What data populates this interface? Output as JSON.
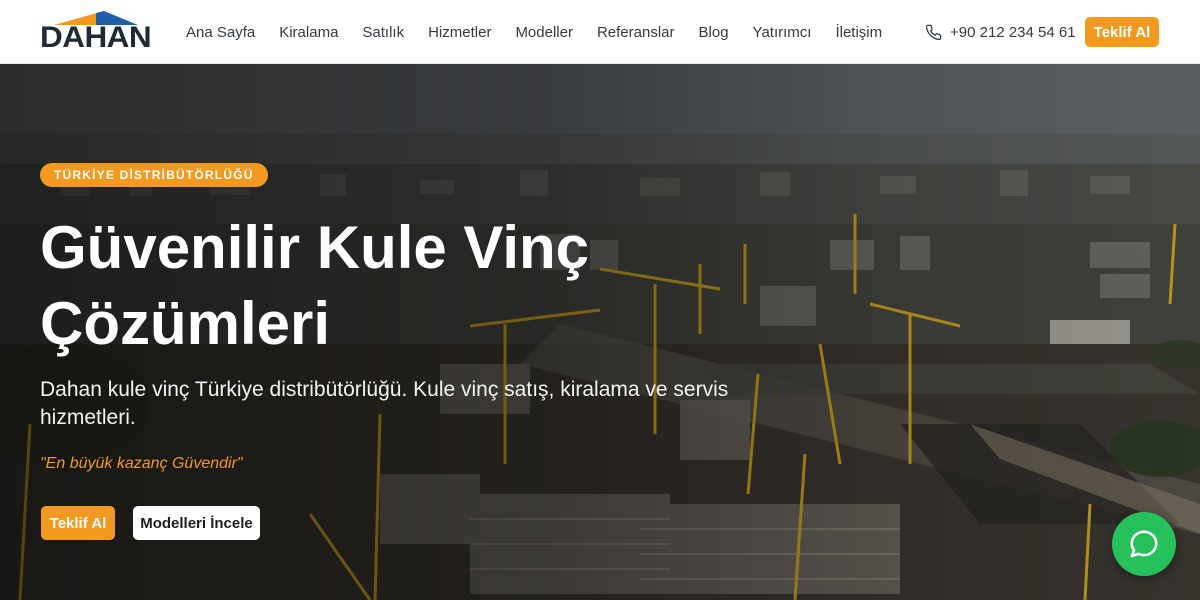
{
  "brand": {
    "name": "DAHAN",
    "colors": {
      "accent": "#f29a1f",
      "dark": "#1e2a36",
      "logo_blue": "#1f5fa8",
      "whatsapp": "#27c15b"
    }
  },
  "nav": {
    "items": [
      {
        "label": "Ana Sayfa"
      },
      {
        "label": "Kiralama"
      },
      {
        "label": "Satılık"
      },
      {
        "label": "Hizmetler"
      },
      {
        "label": "Modeller"
      },
      {
        "label": "Referanslar"
      },
      {
        "label": "Blog"
      },
      {
        "label": "Yatırımcı"
      },
      {
        "label": "İletişim"
      }
    ]
  },
  "header": {
    "phone": "+90 212 234 54 61",
    "phone_icon": "phone-icon",
    "cta_label": "Teklif Al"
  },
  "hero": {
    "badge": "TÜRKİYE DİSTRİBÜTÖRLÜĞÜ",
    "title": "Güvenilir Kule Vinç Çözümleri",
    "description": "Dahan kule vinç Türkiye distribütörlüğü. Kule vinç satış, kiralama ve servis hizmetleri.",
    "quote": "\"En büyük kazanç Güvendir\"",
    "primary_button": "Teklif Al",
    "secondary_button": "Modelleri İncele",
    "background_image": "aerial construction site with tower cranes"
  },
  "chat_button": {
    "icon": "whatsapp-chat-icon"
  }
}
